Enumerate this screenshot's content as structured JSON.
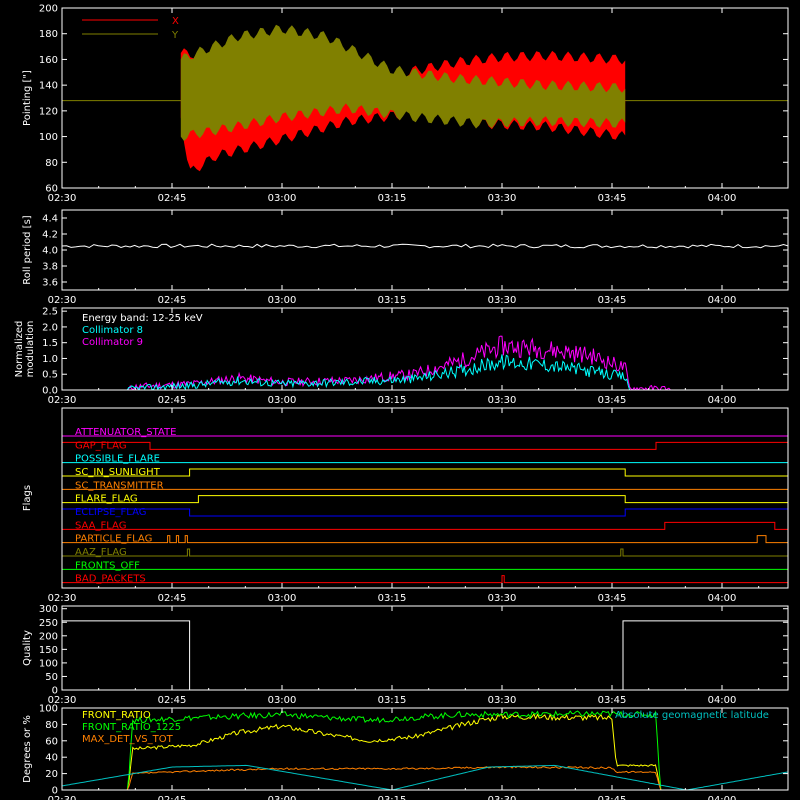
{
  "chart_data": [
    {
      "type": "line",
      "ylabel": "Pointing [\"]",
      "ylim": [
        60,
        200
      ],
      "yticks": [
        60,
        80,
        100,
        120,
        140,
        160,
        180,
        200
      ],
      "series": [
        {
          "name": "X",
          "color": "#ff0000",
          "envelope_upper": [
            [
              0,
              0
            ],
            [
              2.75,
              0
            ],
            [
              2.77,
              165
            ],
            [
              2.9,
              162
            ],
            [
              3.1,
              150
            ],
            [
              3.25,
              148
            ],
            [
              3.4,
              158
            ],
            [
              3.5,
              162
            ],
            [
              3.6,
              163
            ],
            [
              3.78,
              160
            ],
            [
              3.8,
              0
            ]
          ],
          "envelope_lower": [
            [
              2.77,
              115
            ],
            [
              2.79,
              72
            ],
            [
              2.85,
              85
            ],
            [
              3.0,
              98
            ],
            [
              3.15,
              112
            ],
            [
              3.3,
              118
            ],
            [
              3.45,
              110
            ],
            [
              3.6,
              108
            ],
            [
              3.78,
              100
            ]
          ]
        },
        {
          "name": "Y",
          "color": "#808000",
          "envelope_upper": [
            [
              2.77,
              160
            ],
            [
              2.9,
              178
            ],
            [
              3.0,
              184
            ],
            [
              3.1,
              178
            ],
            [
              3.25,
              152
            ],
            [
              3.4,
              145
            ],
            [
              3.6,
              140
            ],
            [
              3.78,
              138
            ]
          ],
          "envelope_lower": [
            [
              2.77,
              100
            ],
            [
              2.9,
              108
            ],
            [
              3.0,
              115
            ],
            [
              3.15,
              122
            ],
            [
              3.3,
              115
            ],
            [
              3.45,
              110
            ],
            [
              3.6,
              112
            ],
            [
              3.78,
              110
            ]
          ],
          "baseline": 128
        }
      ]
    },
    {
      "type": "line",
      "ylabel": "Roll period [s]",
      "ylim": [
        3.5,
        4.5
      ],
      "yticks": [
        3.6,
        3.8,
        4.0,
        4.2,
        4.4
      ],
      "series": [
        {
          "name": "",
          "color": "#ffffff",
          "constant": 4.05
        }
      ]
    },
    {
      "type": "line",
      "ylabel": "Normalized modulation",
      "ylim": [
        0,
        2.6
      ],
      "yticks": [
        0.0,
        0.5,
        1.0,
        1.5,
        2.0,
        2.5
      ],
      "annotation": "Energy band: 12-25 keV",
      "series": [
        {
          "name": "Collimator 8",
          "color": "#00ffff",
          "profile": [
            [
              2.65,
              0.0
            ],
            [
              2.66,
              0.05
            ],
            [
              2.8,
              0.15
            ],
            [
              2.9,
              0.3
            ],
            [
              3.0,
              0.2
            ],
            [
              3.15,
              0.25
            ],
            [
              3.3,
              0.35
            ],
            [
              3.4,
              0.6
            ],
            [
              3.5,
              0.9
            ],
            [
              3.6,
              0.8
            ],
            [
              3.7,
              0.6
            ],
            [
              3.78,
              0.4
            ],
            [
              3.79,
              0.0
            ]
          ]
        },
        {
          "name": "Collimator 9",
          "color": "#ff00ff",
          "profile": [
            [
              2.65,
              0.0
            ],
            [
              2.66,
              0.1
            ],
            [
              2.8,
              0.2
            ],
            [
              2.9,
              0.38
            ],
            [
              3.0,
              0.25
            ],
            [
              3.15,
              0.3
            ],
            [
              3.3,
              0.5
            ],
            [
              3.4,
              0.9
            ],
            [
              3.5,
              1.4
            ],
            [
              3.6,
              1.3
            ],
            [
              3.7,
              1.1
            ],
            [
              3.78,
              0.7
            ],
            [
              3.79,
              0.05
            ],
            [
              3.87,
              0.05
            ],
            [
              3.88,
              0.0
            ]
          ]
        }
      ]
    },
    {
      "type": "line",
      "ylabel": "Flags",
      "flags": [
        {
          "name": "ATTENUATOR_STATE",
          "color": "#ff00ff",
          "steps": []
        },
        {
          "name": "GAP_FLAG",
          "color": "#ff0000",
          "steps": [
            [
              2.5,
              1
            ],
            [
              2.7,
              0
            ],
            [
              3.85,
              1
            ],
            [
              4.15,
              1
            ]
          ]
        },
        {
          "name": "POSSIBLE_FLARE",
          "color": "#00ffff",
          "steps": []
        },
        {
          "name": "SC_IN_SUNLIGHT",
          "color": "#ffff00",
          "steps": [
            [
              2.5,
              0
            ],
            [
              2.79,
              1
            ],
            [
              3.78,
              0
            ]
          ]
        },
        {
          "name": "SC_TRANSMITTER",
          "color": "#ff8000",
          "steps": []
        },
        {
          "name": "FLARE_FLAG",
          "color": "#ffff00",
          "steps": [
            [
              2.5,
              0
            ],
            [
              2.81,
              1
            ],
            [
              3.78,
              0
            ]
          ]
        },
        {
          "name": "ECLIPSE_FLAG",
          "color": "#0000ff",
          "steps": [
            [
              2.5,
              1
            ],
            [
              2.79,
              0
            ],
            [
              3.78,
              1
            ]
          ]
        },
        {
          "name": "SAA_FLAG",
          "color": "#ff0000",
          "steps": [
            [
              2.5,
              0
            ],
            [
              3.87,
              1
            ],
            [
              4.12,
              0
            ]
          ]
        },
        {
          "name": "PARTICLE_FLAG",
          "color": "#ff8000",
          "steps": [
            [
              2.5,
              0
            ],
            [
              2.74,
              1
            ],
            [
              2.745,
              0
            ],
            [
              2.76,
              1
            ],
            [
              2.765,
              0
            ],
            [
              2.78,
              1
            ],
            [
              2.785,
              0
            ],
            [
              4.08,
              1
            ],
            [
              4.1,
              0
            ]
          ]
        },
        {
          "name": "AAZ_FLAG",
          "color": "#808000",
          "steps": [
            [
              2.5,
              0
            ],
            [
              2.785,
              1
            ],
            [
              2.79,
              0
            ],
            [
              3.77,
              1
            ],
            [
              3.775,
              0
            ]
          ]
        },
        {
          "name": "FRONTS_OFF",
          "color": "#00ff00",
          "steps": []
        },
        {
          "name": "BAD_PACKETS",
          "color": "#ff0000",
          "steps": [
            [
              2.5,
              0
            ],
            [
              3.5,
              1
            ],
            [
              3.505,
              0
            ]
          ]
        }
      ]
    },
    {
      "type": "line",
      "ylabel": "Quality",
      "ylim": [
        0,
        310
      ],
      "yticks": [
        0,
        50,
        100,
        150,
        200,
        250,
        300
      ],
      "series": [
        {
          "name": "",
          "color": "#ffffff",
          "steps": [
            [
              2.5,
              255
            ],
            [
              2.79,
              0
            ],
            [
              3.775,
              255
            ],
            [
              4.15,
              255
            ]
          ]
        }
      ]
    },
    {
      "type": "line",
      "ylabel": "Degrees or %",
      "ylim": [
        0,
        100
      ],
      "yticks": [
        0,
        20,
        40,
        60,
        80,
        100
      ],
      "series": [
        {
          "name": "FRONT_RATIO",
          "color": "#ffff00",
          "profile": [
            [
              2.5,
              0
            ],
            [
              2.65,
              0
            ],
            [
              2.66,
              50
            ],
            [
              2.8,
              55
            ],
            [
              2.9,
              70
            ],
            [
              3.0,
              78
            ],
            [
              3.1,
              68
            ],
            [
              3.2,
              60
            ],
            [
              3.3,
              65
            ],
            [
              3.45,
              85
            ],
            [
              3.5,
              90
            ],
            [
              3.75,
              88
            ],
            [
              3.76,
              30
            ],
            [
              3.85,
              30
            ],
            [
              3.86,
              0
            ]
          ]
        },
        {
          "name": "FRONT_RATIO_1225",
          "color": "#00ff00",
          "profile": [
            [
              2.5,
              0
            ],
            [
              2.65,
              0
            ],
            [
              2.66,
              85
            ],
            [
              2.8,
              88
            ],
            [
              3.0,
              92
            ],
            [
              3.2,
              85
            ],
            [
              3.4,
              92
            ],
            [
              3.5,
              92
            ],
            [
              3.75,
              93
            ],
            [
              3.76,
              92
            ],
            [
              3.85,
              92
            ],
            [
              3.86,
              0
            ]
          ]
        },
        {
          "name": "MAX_DET_VS_TOT",
          "color": "#ff8000",
          "profile": [
            [
              2.5,
              0
            ],
            [
              2.65,
              0
            ],
            [
              2.66,
              20
            ],
            [
              2.8,
              23
            ],
            [
              3.0,
              26
            ],
            [
              3.3,
              26
            ],
            [
              3.5,
              28
            ],
            [
              3.75,
              27
            ],
            [
              3.76,
              22
            ],
            [
              3.85,
              22
            ],
            [
              3.86,
              0
            ]
          ]
        },
        {
          "name": "Absolute geomagnetic latitude",
          "color": "#00c0c0",
          "profile": [
            [
              2.5,
              5
            ],
            [
              2.75,
              28
            ],
            [
              2.92,
              30
            ],
            [
              3.25,
              0
            ],
            [
              3.47,
              28
            ],
            [
              3.62,
              30
            ],
            [
              3.92,
              0
            ],
            [
              4.15,
              22
            ]
          ]
        }
      ]
    }
  ],
  "x_axis": {
    "xlim": [
      2.5,
      4.15
    ],
    "ticks": [
      {
        "v": 2.5,
        "label": "02:30"
      },
      {
        "v": 2.75,
        "label": "02:45"
      },
      {
        "v": 3.0,
        "label": "03:00"
      },
      {
        "v": 3.25,
        "label": "03:15"
      },
      {
        "v": 3.5,
        "label": "03:30"
      },
      {
        "v": 3.75,
        "label": "03:45"
      },
      {
        "v": 4.0,
        "label": "04:00"
      }
    ]
  },
  "colors": {
    "background": "#000000",
    "axes": "#ffffff",
    "text": "#ffffff"
  }
}
